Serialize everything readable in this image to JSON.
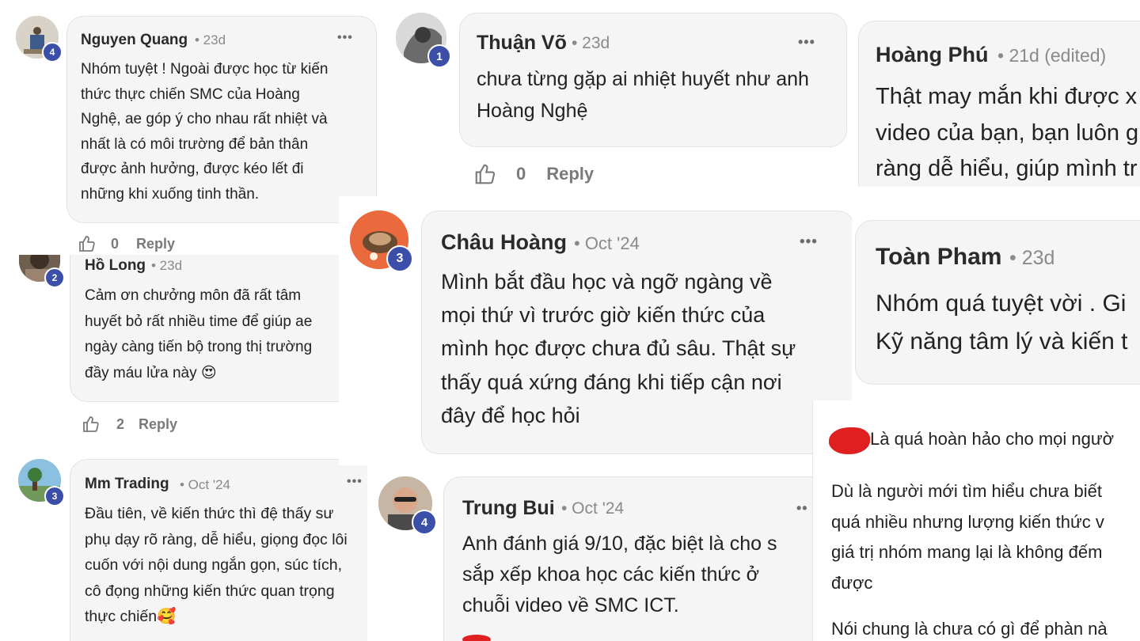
{
  "comments": [
    {
      "name": "Nguyen Quang",
      "time": "• 23d",
      "level": "4",
      "menu": "•••",
      "text": "Nhóm tuyệt ! Ngoài được học từ kiến\nthức thực chiến SMC của Hoàng\nNghệ, ae góp ý cho nhau rất nhiệt và\nnhất là có môi trường để bản thân\nđược ảnh hưởng, được kéo lết đi\nnhững khi xuống tinh thần.",
      "likes": "0",
      "reply": "Reply"
    },
    {
      "name": "Hồ Long",
      "time": "• 23d",
      "level": "2",
      "text": "Cảm ơn chưởng môn đã rất tâm\nhuyết bỏ rất nhiều time để giúp ae\nngày càng tiến bộ trong thị trường\nđầy máu lửa này 😍",
      "likes": "2",
      "reply": "Reply"
    },
    {
      "name": "Mm Trading",
      "time": "• Oct '24",
      "level": "3",
      "menu": "•••",
      "text": "Đầu tiên, về kiến thức thì đệ thấy sư\nphụ dạy rõ ràng, dễ hiểu, giọng đọc lôi\ncuốn với nội dung ngắn gọn, súc tích,\ncô đọng những kiến thức quan trọng\nthực chiến🥰"
    },
    {
      "name": "Thuận Võ",
      "time": "• 23d",
      "level": "1",
      "menu": "•••",
      "text": "chưa từng gặp ai nhiệt huyết như anh\nHoàng Nghệ",
      "likes": "0",
      "reply": "Reply"
    },
    {
      "name": "Châu Hoàng",
      "time": "• Oct '24",
      "level": "3",
      "menu": "•••",
      "text": "Mình bắt đầu học và ngỡ ngàng về\nmọi thứ vì trước giờ kiến thức của\nmình học được chưa đủ sâu. Thật sự\nthấy quá xứng đáng khi tiếp cận nơi\nđây để học hỏi"
    },
    {
      "name": "Trung Bui",
      "time": "• Oct '24",
      "level": "4",
      "menu": "••",
      "text": "Anh đánh giá 9/10, đặc biệt là cho s\nsắp xếp khoa học các kiến thức ở\nchuỗi video về SMC ICT."
    },
    {
      "name": "Hoàng Phú",
      "time": "• 21d (edited)",
      "text": "Thật may mắn khi được x\nvideo của bạn, bạn luôn g\nràng dễ hiểu, giúp mình tr"
    },
    {
      "name": "Toàn Pham",
      "time": "• 23d",
      "text": "Nhóm quá tuyệt vời . Gi\nKỹ năng tâm lý và kiến t"
    }
  ],
  "post": {
    "line1": "Là quá hoàn hảo cho mọi ngườ",
    "para1": "Dù là người mới tìm hiểu chưa biết\nquá nhiều nhưng lượng kiến thức v\ngiá trị nhóm mang lại là không đếm\nđược",
    "line_last": "Nói chung là chưa có gì để phàn nà"
  },
  "colors": {
    "badge": "#3b4fa8",
    "card": "#f5f5f5",
    "muted": "#8a8a8a",
    "redaction": "#e02020"
  },
  "icons": {
    "like": "thumbs-up-icon",
    "menu": "more-horizontal-icon"
  }
}
